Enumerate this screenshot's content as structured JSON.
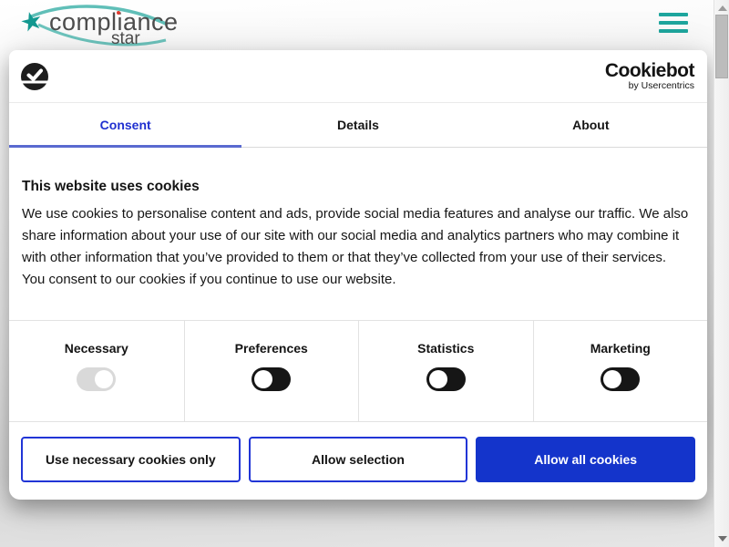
{
  "site": {
    "brand": {
      "main": "compliance",
      "sub": "star"
    },
    "colors": {
      "teal": "#1ea69e",
      "logo_text": "#4d4d4d",
      "dot_red": "#e03c31"
    }
  },
  "scrollbar": {
    "thumb_position": "top"
  },
  "dialog": {
    "vendor": {
      "wordmark": "Cookiebot",
      "byline": "by Usercentrics"
    },
    "tabs": [
      {
        "label": "Consent",
        "active": true
      },
      {
        "label": "Details",
        "active": false
      },
      {
        "label": "About",
        "active": false
      }
    ],
    "title": "This website uses cookies",
    "description": "We use cookies to personalise content and ads, provide social media features and analyse our traffic. We also share information about your use of our site with our social media and analytics partners who may combine it with other information that you’ve provided to them or that they’ve collected from your use of their services. You consent to our cookies if you continue to use our website.",
    "categories": [
      {
        "label": "Necessary",
        "state": "on-disabled"
      },
      {
        "label": "Preferences",
        "state": "off"
      },
      {
        "label": "Statistics",
        "state": "off"
      },
      {
        "label": "Marketing",
        "state": "off"
      }
    ],
    "buttons": [
      {
        "label": "Use necessary cookies only",
        "style": "outline"
      },
      {
        "label": "Allow selection",
        "style": "outline"
      },
      {
        "label": "Allow all cookies",
        "style": "primary"
      }
    ],
    "colors": {
      "accent_blue": "#1434cb",
      "active_tab": "#2030d0",
      "tab_underline": "#5a6ad0",
      "toggle_dark": "#161616",
      "toggle_gray": "#d9d9d9"
    }
  }
}
